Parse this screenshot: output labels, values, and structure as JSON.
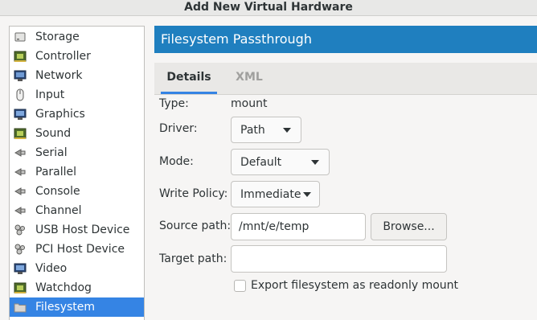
{
  "window": {
    "title": "Add New Virtual Hardware"
  },
  "sidebar": {
    "items": [
      {
        "label": "Storage",
        "icon": "disk-icon"
      },
      {
        "label": "Controller",
        "icon": "controller-chip-icon"
      },
      {
        "label": "Network",
        "icon": "network-monitor-icon"
      },
      {
        "label": "Input",
        "icon": "mouse-icon"
      },
      {
        "label": "Graphics",
        "icon": "display-icon"
      },
      {
        "label": "Sound",
        "icon": "sound-card-icon"
      },
      {
        "label": "Serial",
        "icon": "serial-plug-icon"
      },
      {
        "label": "Parallel",
        "icon": "parallel-plug-icon"
      },
      {
        "label": "Console",
        "icon": "console-plug-icon"
      },
      {
        "label": "Channel",
        "icon": "channel-plug-icon"
      },
      {
        "label": "USB Host Device",
        "icon": "usb-device-icon"
      },
      {
        "label": "PCI Host Device",
        "icon": "pci-device-icon"
      },
      {
        "label": "Video",
        "icon": "video-display-icon"
      },
      {
        "label": "Watchdog",
        "icon": "watchdog-chip-icon"
      },
      {
        "label": "Filesystem",
        "icon": "folder-icon",
        "selected": true
      }
    ]
  },
  "panel": {
    "title": "Filesystem Passthrough",
    "tabs": [
      {
        "label": "Details",
        "active": true
      },
      {
        "label": "XML",
        "active": false
      }
    ]
  },
  "form": {
    "type_label": "Type:",
    "type_value": "mount",
    "driver_label": "Driver:",
    "driver_value": "Path",
    "mode_label": "Mode:",
    "mode_value": "Default",
    "write_policy_label": "Write Policy:",
    "write_policy_value": "Immediate",
    "source_path_label": "Source path:",
    "source_path_value": "/mnt/e/temp",
    "browse_label": "Browse...",
    "target_path_label": "Target path:",
    "target_path_value": "",
    "readonly_label": "Export filesystem as readonly mount",
    "readonly_checked": false
  },
  "colors": {
    "header_bg": "#1f7fbf",
    "selection_bg": "#3584e4",
    "tab_indicator": "#3584e4"
  }
}
